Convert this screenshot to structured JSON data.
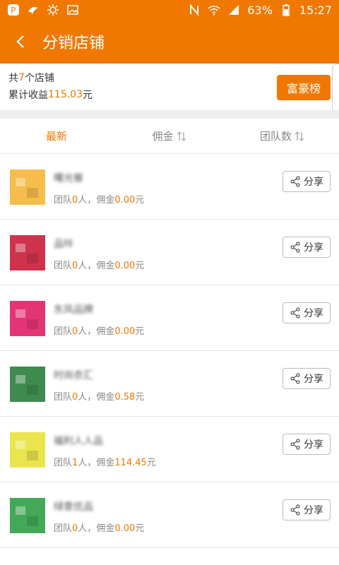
{
  "status_bar": {
    "battery": "63%",
    "time": "15:27",
    "left_icons": [
      "app-p-icon",
      "bird-icon",
      "sun-icon",
      "image-icon"
    ],
    "right_icons": [
      "nfc-icon",
      "wifi-icon",
      "signal-icon",
      "battery-icon"
    ]
  },
  "header": {
    "title": "分销店铺"
  },
  "summary": {
    "shops_prefix": "共",
    "shops_count": "7",
    "shops_suffix": "个店铺",
    "earnings_label": "累计收益",
    "earnings_value": "115.03",
    "earnings_unit": "元",
    "rich_button": "富豪榜"
  },
  "tabs": [
    {
      "label": "最新",
      "active": true,
      "sort_icon": false
    },
    {
      "label": "佣金",
      "active": false,
      "sort_icon": true
    },
    {
      "label": "团队数",
      "active": false,
      "sort_icon": true
    }
  ],
  "shops": [
    {
      "name": "曙光餐",
      "team_label": "团队",
      "team_count": "0",
      "team_unit": "人，",
      "commission_label": "佣金",
      "commission": "0.00",
      "commission_unit": "元",
      "share_label": "分享",
      "thumb_color": "#f5b63a"
    },
    {
      "name": "品咔",
      "team_label": "团队",
      "team_count": "0",
      "team_unit": "人，",
      "commission_label": "佣金",
      "commission": "0.00",
      "commission_unit": "元",
      "share_label": "分享",
      "thumb_color": "#c91d3a"
    },
    {
      "name": "东风品牌",
      "team_label": "团队",
      "team_count": "0",
      "team_unit": "人，",
      "commission_label": "佣金",
      "commission": "0.00",
      "commission_unit": "元",
      "share_label": "分享",
      "thumb_color": "#e01f67"
    },
    {
      "name": "时尚衣汇",
      "team_label": "团队",
      "team_count": "0",
      "team_unit": "人，",
      "commission_label": "佣金",
      "commission": "0.58",
      "commission_unit": "元",
      "share_label": "分享",
      "thumb_color": "#2a7d3c"
    },
    {
      "name": "福利人人品",
      "team_label": "团队",
      "team_count": "1",
      "team_unit": "人，",
      "commission_label": "佣金",
      "commission": "114.45",
      "commission_unit": "元",
      "share_label": "分享",
      "thumb_color": "#e8e23a"
    },
    {
      "name": "绿意优品",
      "team_label": "团队",
      "team_count": "0",
      "team_unit": "人，",
      "commission_label": "佣金",
      "commission": "0.00",
      "commission_unit": "元",
      "share_label": "分享",
      "thumb_color": "#2f9e46"
    }
  ],
  "colors": {
    "accent": "#f07800",
    "status_bar": "#f07800"
  }
}
